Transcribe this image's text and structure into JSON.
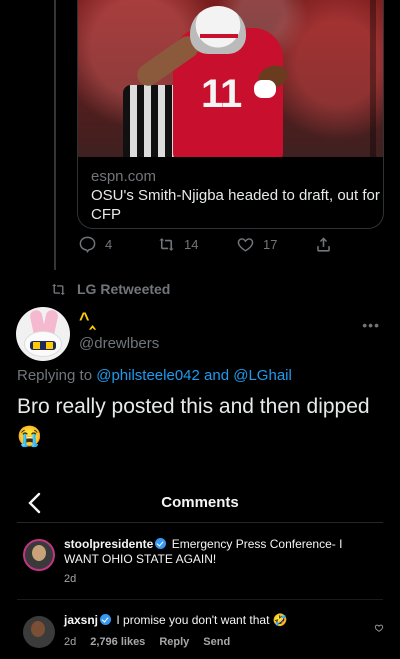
{
  "card": {
    "image_alt": "",
    "domain": "espn.com",
    "title": "OSU's Smith-Njigba headed to draft, out for CFP",
    "jersey_number": "11"
  },
  "actions": {
    "replies": "4",
    "retweets": "14",
    "likes": "17"
  },
  "retweet_header": "LG Retweeted",
  "tweet": {
    "display_name": "^‸",
    "username": "@drewlbers",
    "replying_prefix": "Replying to ",
    "mention_1": "@philsteele042",
    "reply_and": " and ",
    "mention_2": "@LGhail",
    "text": "Bro really posted this and then dipped",
    "emoji": "😭"
  },
  "comments_panel": {
    "title": "Comments",
    "comments": [
      {
        "user": "stoolpresidente",
        "text": "Emergency Press Conference- I WANT OHIO STATE AGAIN!",
        "time": "2d"
      },
      {
        "user": "jaxsnj",
        "text": "I promise you don't want that 🤣",
        "time": "2d",
        "likes": "2,796 likes",
        "reply_label": "Reply",
        "send_label": "Send"
      }
    ]
  },
  "colors": {
    "background": "#000000",
    "text": "#e7e9ea",
    "muted": "#71767b",
    "mention": "#1d9bf0",
    "display_name": "#ffcb05",
    "instagram_verified": "#3897f0"
  }
}
